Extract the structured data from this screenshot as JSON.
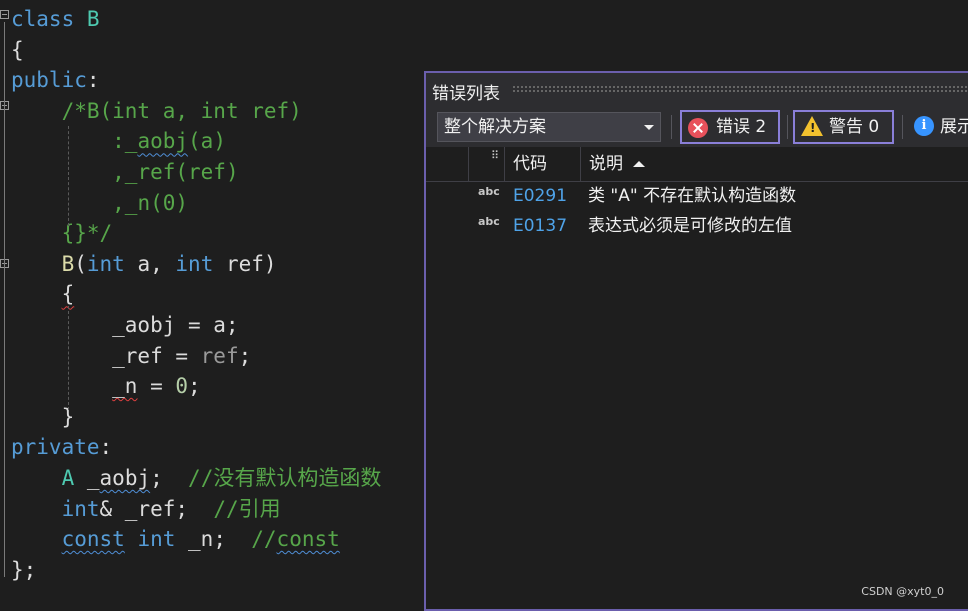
{
  "code_lines": [
    {
      "parts": [
        [
          "kw",
          "class "
        ],
        [
          "ty",
          "B"
        ]
      ]
    },
    {
      "parts": [
        [
          "tx",
          "{"
        ]
      ]
    },
    {
      "parts": [
        [
          "kw",
          "public"
        ],
        [
          "tx",
          ":"
        ]
      ]
    },
    {
      "parts": [
        [
          "tx",
          "    "
        ],
        [
          "cm",
          "/*B(int a, int ref)"
        ]
      ]
    },
    {
      "parts": [
        [
          "tx",
          "        "
        ],
        [
          "cm",
          ":_aobj(a)"
        ]
      ]
    },
    {
      "parts": [
        [
          "tx",
          "        "
        ],
        [
          "cm",
          ",_ref(ref)"
        ]
      ]
    },
    {
      "parts": [
        [
          "tx",
          "        "
        ],
        [
          "cm",
          ",_n(0)"
        ]
      ]
    },
    {
      "parts": [
        [
          "tx",
          "    "
        ],
        [
          "cm",
          "{}*/"
        ]
      ]
    },
    {
      "parts": [
        [
          "tx",
          "    "
        ],
        [
          "fn",
          "B"
        ],
        [
          "tx",
          "("
        ],
        [
          "kw",
          "int"
        ],
        [
          "tx",
          " a, "
        ],
        [
          "kw",
          "int"
        ],
        [
          "tx",
          " ref)"
        ]
      ]
    },
    {
      "parts": [
        [
          "tx",
          "    {"
        ]
      ]
    },
    {
      "parts": [
        [
          "tx",
          "        _aobj = a;"
        ]
      ]
    },
    {
      "parts": [
        [
          "tx",
          "        _ref = "
        ],
        [
          "pa",
          "ref"
        ],
        [
          "tx",
          ";"
        ]
      ]
    },
    {
      "parts": [
        [
          "tx",
          "        _n = "
        ],
        [
          "nm",
          "0"
        ],
        [
          "tx",
          ";"
        ]
      ]
    },
    {
      "parts": [
        [
          "tx",
          "    }"
        ]
      ]
    },
    {
      "parts": [
        [
          "kw",
          "private"
        ],
        [
          "tx",
          ":"
        ]
      ]
    },
    {
      "parts": [
        [
          "tx",
          "    "
        ],
        [
          "ty",
          "A"
        ],
        [
          "tx",
          " _aobj;  "
        ],
        [
          "cm",
          "//没有默认构造函数"
        ]
      ]
    },
    {
      "parts": [
        [
          "tx",
          "    "
        ],
        [
          "kw",
          "int"
        ],
        [
          "tx",
          "& _ref;  "
        ],
        [
          "cm",
          "//引用"
        ]
      ]
    },
    {
      "parts": [
        [
          "tx",
          "    "
        ],
        [
          "kw",
          "const"
        ],
        [
          "tx",
          " "
        ],
        [
          "kw",
          "int"
        ],
        [
          "tx",
          " _n;  "
        ],
        [
          "cm",
          "//const"
        ]
      ]
    },
    {
      "parts": [
        [
          "tx",
          "};"
        ]
      ]
    }
  ],
  "error_list": {
    "title": "错误列表",
    "scope": "整个解决方案",
    "errors_label": "错误 2",
    "warnings_label": "警告 0",
    "messages_label": "展示",
    "columns": {
      "code": "代码",
      "description": "说明"
    },
    "rows": [
      {
        "icon": "spell-check-icon",
        "code": "E0291",
        "description": "类 \"A\" 不存在默认构造函数"
      },
      {
        "icon": "spell-check-icon",
        "code": "E0137",
        "description": "表达式必须是可修改的左值"
      }
    ]
  },
  "watermark": "CSDN @xyt0_0",
  "colors": {
    "keyword": "#569cd6",
    "type": "#4ec9b0",
    "comment": "#57a64a",
    "error_code": "#4fa3e8",
    "panel_border": "#6b5fad"
  }
}
